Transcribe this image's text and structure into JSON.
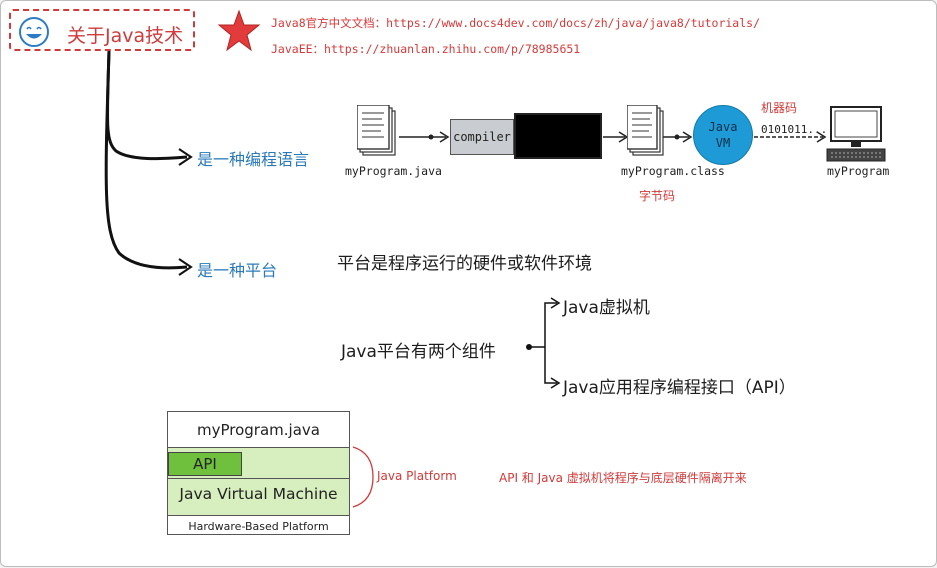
{
  "title": "关于Java技术",
  "links": [
    "Java8官方中文文档：https://www.docs4dev.com/docs/zh/java/java8/tutorials/",
    "JavaEE：https://zhuanlan.zhihu.com/p/78985651"
  ],
  "branches": {
    "language": "是一种编程语言",
    "platform": "是一种平台"
  },
  "flow": {
    "source_file": "myProgram.java",
    "compiler": "compiler",
    "class_file": "myProgram.class",
    "bytecode_label": "字节码",
    "jvm_line1": "Java",
    "jvm_line2": "VM",
    "machine_code_label": "机器码",
    "binary": "0101011...",
    "output": "myProgram"
  },
  "platform_desc": "平台是程序运行的硬件或软件环境",
  "components": {
    "root": "Java平台有两个组件",
    "item1": "Java虚拟机",
    "item2": "Java应用程序编程接口（API）"
  },
  "stack": {
    "program": "myProgram.java",
    "api": "API",
    "jvm": "Java Virtual Machine",
    "hardware": "Hardware-Based Platform",
    "platform_label": "Java Platform"
  },
  "note": "API 和 Java 虚拟机将程序与底层硬件隔离开来",
  "colors": {
    "accent_red": "#cf3a3a",
    "branch_blue": "#2a7ab8",
    "jvm_blue": "#1e9bd6",
    "api_green": "#6fc13d",
    "platform_green": "#d7eebe"
  }
}
